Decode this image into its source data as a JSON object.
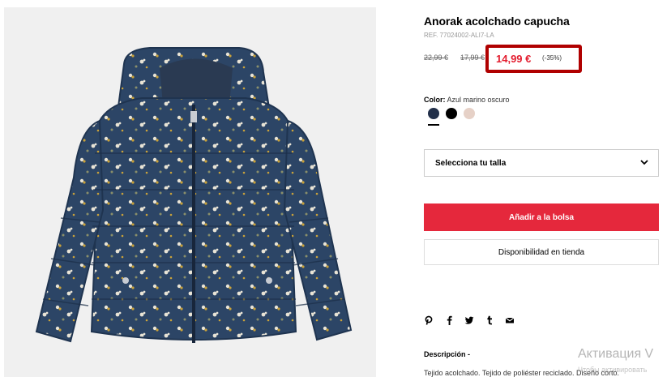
{
  "product": {
    "title": "Anorak acolchado capucha",
    "ref": "REF. 77024002-ALI7-LA",
    "old_price_1": "22,99 €",
    "old_price_2": "17,99 €",
    "price": "14,99 €",
    "discount": "(-35%)"
  },
  "color": {
    "label": "Color:",
    "value": "Azul marino oscuro",
    "swatches": [
      "#22304a",
      "#000000",
      "#e6d1c7"
    ]
  },
  "size_select": {
    "label": "Selecciona tu talla"
  },
  "buttons": {
    "add_to_bag": "Añadir a la bolsa",
    "store_availability": "Disponibilidad en tienda"
  },
  "share_icons": [
    "pinterest-icon",
    "facebook-icon",
    "twitter-icon",
    "tumblr-icon",
    "mail-icon"
  ],
  "description": {
    "title": "Descripción -",
    "text": "Tejido acolchado. Tejido de poliéster reciclado. Diseño corto."
  },
  "watermark": {
    "line1": "Активация V",
    "line2": "Чтобы активировать"
  }
}
